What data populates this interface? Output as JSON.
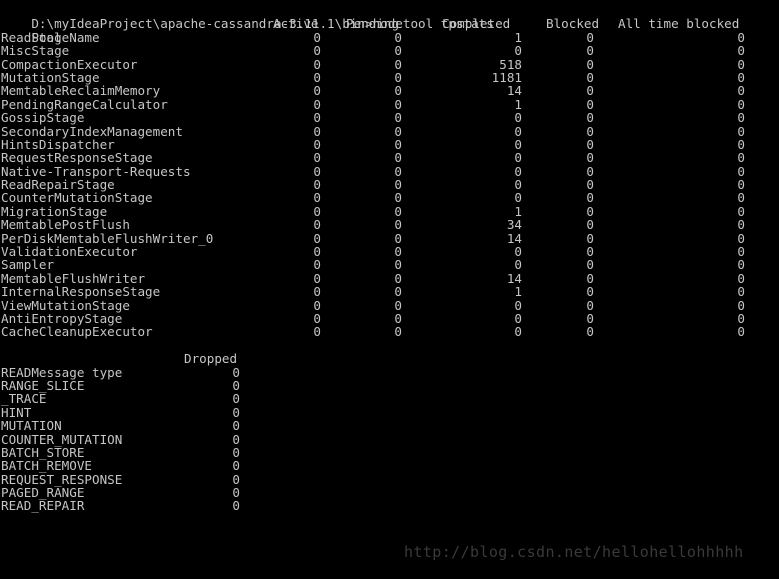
{
  "terminal": {
    "prompt_line": "D:\\myIdeaProject\\apache-cassandra-3.11.1\\bin>nodetool tpstats",
    "colors": {
      "background": "#000000",
      "foreground": "#c6c6c6",
      "watermark": "#3a3a3a"
    }
  },
  "thread_pools": {
    "headers": {
      "name": "Pool Name",
      "active": "Active",
      "pending": "Pending",
      "completed": "Completed",
      "blocked": "Blocked",
      "all_time_blocked": "All time blocked"
    },
    "rows": [
      {
        "name": "ReadStage",
        "active": "0",
        "pending": "0",
        "completed": "1",
        "blocked": "0",
        "all_time_blocked": "0"
      },
      {
        "name": "MiscStage",
        "active": "0",
        "pending": "0",
        "completed": "0",
        "blocked": "0",
        "all_time_blocked": "0"
      },
      {
        "name": "CompactionExecutor",
        "active": "0",
        "pending": "0",
        "completed": "518",
        "blocked": "0",
        "all_time_blocked": "0"
      },
      {
        "name": "MutationStage",
        "active": "0",
        "pending": "0",
        "completed": "1181",
        "blocked": "0",
        "all_time_blocked": "0"
      },
      {
        "name": "MemtableReclaimMemory",
        "active": "0",
        "pending": "0",
        "completed": "14",
        "blocked": "0",
        "all_time_blocked": "0"
      },
      {
        "name": "PendingRangeCalculator",
        "active": "0",
        "pending": "0",
        "completed": "1",
        "blocked": "0",
        "all_time_blocked": "0"
      },
      {
        "name": "GossipStage",
        "active": "0",
        "pending": "0",
        "completed": "0",
        "blocked": "0",
        "all_time_blocked": "0"
      },
      {
        "name": "SecondaryIndexManagement",
        "active": "0",
        "pending": "0",
        "completed": "0",
        "blocked": "0",
        "all_time_blocked": "0"
      },
      {
        "name": "HintsDispatcher",
        "active": "0",
        "pending": "0",
        "completed": "0",
        "blocked": "0",
        "all_time_blocked": "0"
      },
      {
        "name": "RequestResponseStage",
        "active": "0",
        "pending": "0",
        "completed": "0",
        "blocked": "0",
        "all_time_blocked": "0"
      },
      {
        "name": "Native-Transport-Requests",
        "active": "0",
        "pending": "0",
        "completed": "0",
        "blocked": "0",
        "all_time_blocked": "0"
      },
      {
        "name": "ReadRepairStage",
        "active": "0",
        "pending": "0",
        "completed": "0",
        "blocked": "0",
        "all_time_blocked": "0"
      },
      {
        "name": "CounterMutationStage",
        "active": "0",
        "pending": "0",
        "completed": "0",
        "blocked": "0",
        "all_time_blocked": "0"
      },
      {
        "name": "MigrationStage",
        "active": "0",
        "pending": "0",
        "completed": "1",
        "blocked": "0",
        "all_time_blocked": "0"
      },
      {
        "name": "MemtablePostFlush",
        "active": "0",
        "pending": "0",
        "completed": "34",
        "blocked": "0",
        "all_time_blocked": "0"
      },
      {
        "name": "PerDiskMemtableFlushWriter_0",
        "active": "0",
        "pending": "0",
        "completed": "14",
        "blocked": "0",
        "all_time_blocked": "0"
      },
      {
        "name": "ValidationExecutor",
        "active": "0",
        "pending": "0",
        "completed": "0",
        "blocked": "0",
        "all_time_blocked": "0"
      },
      {
        "name": "Sampler",
        "active": "0",
        "pending": "0",
        "completed": "0",
        "blocked": "0",
        "all_time_blocked": "0"
      },
      {
        "name": "MemtableFlushWriter",
        "active": "0",
        "pending": "0",
        "completed": "14",
        "blocked": "0",
        "all_time_blocked": "0"
      },
      {
        "name": "InternalResponseStage",
        "active": "0",
        "pending": "0",
        "completed": "1",
        "blocked": "0",
        "all_time_blocked": "0"
      },
      {
        "name": "ViewMutationStage",
        "active": "0",
        "pending": "0",
        "completed": "0",
        "blocked": "0",
        "all_time_blocked": "0"
      },
      {
        "name": "AntiEntropyStage",
        "active": "0",
        "pending": "0",
        "completed": "0",
        "blocked": "0",
        "all_time_blocked": "0"
      },
      {
        "name": "CacheCleanupExecutor",
        "active": "0",
        "pending": "0",
        "completed": "0",
        "blocked": "0",
        "all_time_blocked": "0"
      }
    ]
  },
  "dropped_messages": {
    "headers": {
      "name": "Message type",
      "dropped": "Dropped"
    },
    "rows": [
      {
        "name": "READ",
        "dropped": "0"
      },
      {
        "name": "RANGE_SLICE",
        "dropped": "0"
      },
      {
        "name": "_TRACE",
        "dropped": "0"
      },
      {
        "name": "HINT",
        "dropped": "0"
      },
      {
        "name": "MUTATION",
        "dropped": "0"
      },
      {
        "name": "COUNTER_MUTATION",
        "dropped": "0"
      },
      {
        "name": "BATCH_STORE",
        "dropped": "0"
      },
      {
        "name": "BATCH_REMOVE",
        "dropped": "0"
      },
      {
        "name": "REQUEST_RESPONSE",
        "dropped": "0"
      },
      {
        "name": "PAGED_RANGE",
        "dropped": "0"
      },
      {
        "name": "READ_REPAIR",
        "dropped": "0"
      }
    ]
  },
  "watermark": {
    "text": "http://blog.csdn.net/hellohellohhhhh"
  }
}
